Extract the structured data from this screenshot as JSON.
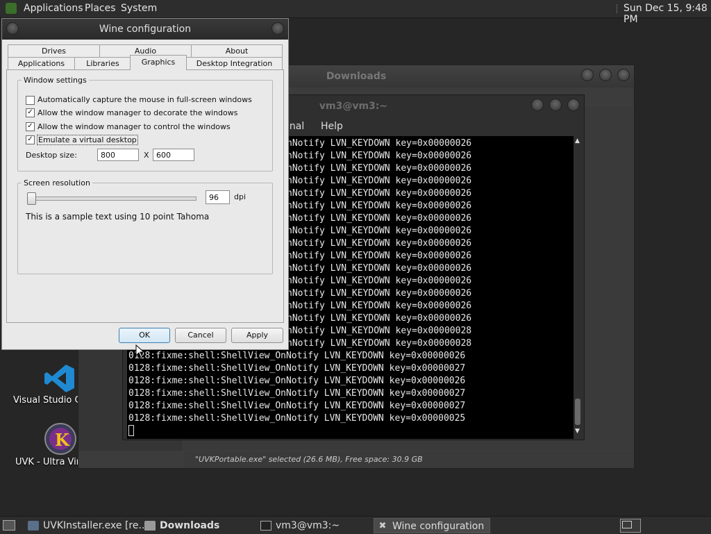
{
  "top_panel": {
    "menus": [
      "Applications",
      "Places",
      "System"
    ],
    "clock": "Sun Dec 15,  9:48 PM"
  },
  "desktop_icons": [
    {
      "label": "Visual Studio Co",
      "icon": "vscode-icon"
    },
    {
      "label": "UVK - Ultra Vir",
      "icon": "uvk-icon"
    }
  ],
  "downloads_window": {
    "title": "Downloads",
    "status": "\"UVKPortable.exe\" selected (26.6 MB), Free space: 30.9 GB"
  },
  "terminal_window": {
    "title": "vm3@vm3:~",
    "menu_visible": [
      "inal",
      "Help"
    ],
    "lines_partial": [
      "nNotify LVN_KEYDOWN key=0x00000026",
      "nNotify LVN_KEYDOWN key=0x00000026",
      "nNotify LVN_KEYDOWN key=0x00000026",
      "nNotify LVN_KEYDOWN key=0x00000026",
      "nNotify LVN_KEYDOWN key=0x00000026",
      "nNotify LVN_KEYDOWN key=0x00000026",
      "nNotify LVN_KEYDOWN key=0x00000026",
      "nNotify LVN_KEYDOWN key=0x00000026",
      "nNotify LVN_KEYDOWN key=0x00000026",
      "nNotify LVN_KEYDOWN key=0x00000026",
      "nNotify LVN_KEYDOWN key=0x00000026",
      "nNotify LVN_KEYDOWN key=0x00000026",
      "nNotify LVN_KEYDOWN key=0x00000026",
      "nNotify LVN_KEYDOWN key=0x00000026",
      "nNotify LVN_KEYDOWN key=0x00000026",
      "nNotify LVN_KEYDOWN key=0x00000028",
      "nNotify LVN_KEYDOWN key=0x00000028"
    ],
    "lines_full": [
      "0128:fixme:shell:ShellView_OnNotify LVN_KEYDOWN key=0x00000026",
      "0128:fixme:shell:ShellView_OnNotify LVN_KEYDOWN key=0x00000027",
      "0128:fixme:shell:ShellView_OnNotify LVN_KEYDOWN key=0x00000026",
      "0128:fixme:shell:ShellView_OnNotify LVN_KEYDOWN key=0x00000027",
      "0128:fixme:shell:ShellView_OnNotify LVN_KEYDOWN key=0x00000027",
      "0128:fixme:shell:ShellView_OnNotify LVN_KEYDOWN key=0x00000025"
    ]
  },
  "wine": {
    "title": "Wine configuration",
    "tabs_row1": [
      "Drives",
      "Audio",
      "About"
    ],
    "tabs_row2": [
      "Applications",
      "Libraries",
      "Graphics",
      "Desktop Integration"
    ],
    "active_tab": "Graphics",
    "window_settings": {
      "legend": "Window settings",
      "options": [
        {
          "label": "Automatically capture the mouse in full-screen windows",
          "checked": false
        },
        {
          "label": "Allow the window manager to decorate the windows",
          "checked": true
        },
        {
          "label": "Allow the window manager to control the windows",
          "checked": true
        },
        {
          "label": "Emulate a virtual desktop",
          "checked": true
        }
      ],
      "desktop_size_label": "Desktop size:",
      "width": "800",
      "x_label": "X",
      "height": "600"
    },
    "screen_resolution": {
      "legend": "Screen resolution",
      "dpi_value": "96",
      "dpi_unit": "dpi",
      "slider_fraction": 0.0,
      "sample_text": "This is a sample text using 10 point Tahoma"
    },
    "buttons": {
      "ok": "OK",
      "cancel": "Cancel",
      "apply": "Apply"
    }
  },
  "taskbar": [
    {
      "label": "UVKInstaller.exe [re...",
      "icon": "installer-icon",
      "active": false
    },
    {
      "label": "Downloads",
      "icon": "folder-icon",
      "active": false
    },
    {
      "label": "vm3@vm3:~",
      "icon": "terminal-icon",
      "active": false
    },
    {
      "label": "Wine configuration",
      "icon": "wine-tools-icon",
      "active": true
    }
  ]
}
